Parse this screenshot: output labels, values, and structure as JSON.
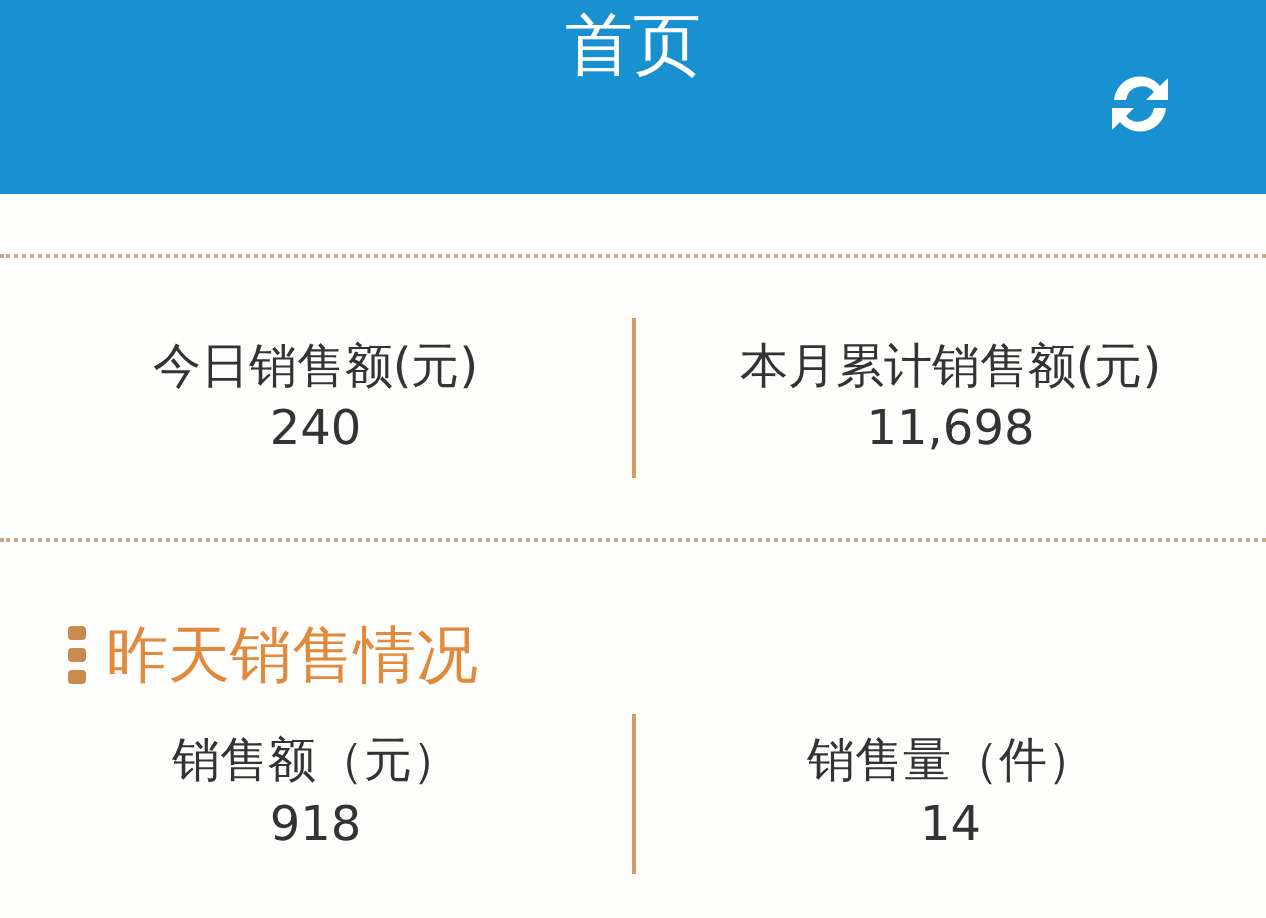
{
  "header": {
    "title": "首页"
  },
  "today_stats": [
    {
      "label": "今日销售额(元)",
      "value": "240"
    },
    {
      "label": "本月累计销售额(元)",
      "value": "11,698"
    }
  ],
  "yesterday": {
    "title": "昨天销售情况",
    "stats": [
      {
        "label": "销售额（元）",
        "value": "918"
      },
      {
        "label": "销售量（件）",
        "value": "14"
      }
    ]
  }
}
